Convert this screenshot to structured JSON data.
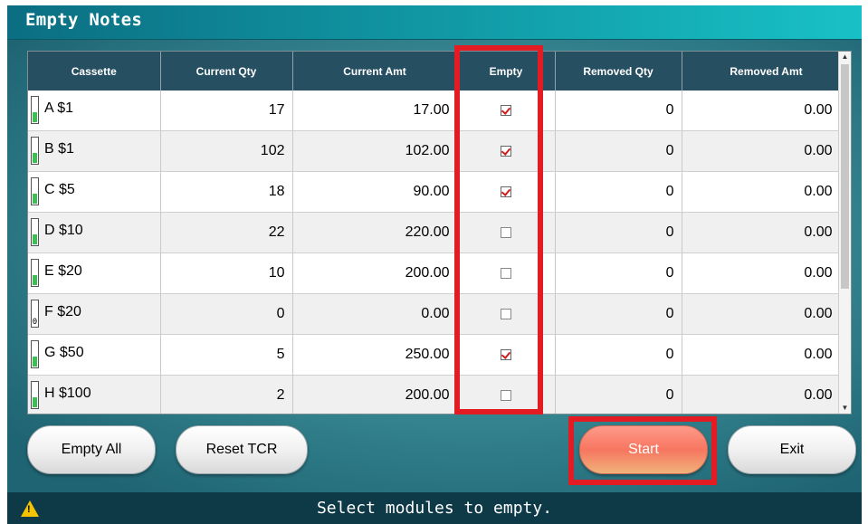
{
  "title": "Empty Notes",
  "columns": [
    "Cassette",
    "Current Qty",
    "Current Amt",
    "Empty",
    "Removed Qty",
    "Removed Amt"
  ],
  "rows": [
    {
      "cassette": "A $1",
      "current_qty": "17",
      "current_amt": "17.00",
      "empty": true,
      "removed_qty": "0",
      "removed_amt": "0.00",
      "gauge": "low"
    },
    {
      "cassette": "B $1",
      "current_qty": "102",
      "current_amt": "102.00",
      "empty": true,
      "removed_qty": "0",
      "removed_amt": "0.00",
      "gauge": "low"
    },
    {
      "cassette": "C $5",
      "current_qty": "18",
      "current_amt": "90.00",
      "empty": true,
      "removed_qty": "0",
      "removed_amt": "0.00",
      "gauge": "low"
    },
    {
      "cassette": "D $10",
      "current_qty": "22",
      "current_amt": "220.00",
      "empty": false,
      "removed_qty": "0",
      "removed_amt": "0.00",
      "gauge": "low"
    },
    {
      "cassette": "E $20",
      "current_qty": "10",
      "current_amt": "200.00",
      "empty": false,
      "removed_qty": "0",
      "removed_amt": "0.00",
      "gauge": "low"
    },
    {
      "cassette": "F $20",
      "current_qty": "0",
      "current_amt": "0.00",
      "empty": false,
      "removed_qty": "0",
      "removed_amt": "0.00",
      "gauge": "empty",
      "gauge_text": "0"
    },
    {
      "cassette": "G $50",
      "current_qty": "5",
      "current_amt": "250.00",
      "empty": true,
      "removed_qty": "0",
      "removed_amt": "0.00",
      "gauge": "low"
    },
    {
      "cassette": "H $100",
      "current_qty": "2",
      "current_amt": "200.00",
      "empty": false,
      "removed_qty": "0",
      "removed_amt": "0.00",
      "gauge": "low"
    }
  ],
  "buttons": {
    "empty_all": "Empty All",
    "reset_tcr": "Reset TCR",
    "start": "Start",
    "exit": "Exit"
  },
  "status": {
    "icon": "warning-icon",
    "message": "Select modules to empty."
  },
  "colors": {
    "header_bg": "#274f62",
    "highlight": "#e31b23",
    "check": "#d11a1a",
    "gauge_fill": "#3dbf56",
    "start_button": "#f77660"
  }
}
